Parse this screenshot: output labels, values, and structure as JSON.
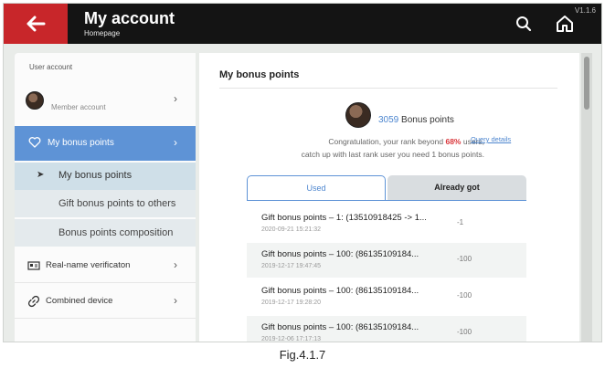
{
  "header": {
    "title": "My account",
    "subtitle": "Homepage",
    "version": "V1.1.6"
  },
  "sidebar": {
    "section_label": "User account",
    "member_label": "Member account",
    "bonus_label": "My bonus points",
    "sub_items": [
      "My bonus points",
      "Gift bonus points to others",
      "Bonus points composition"
    ],
    "realname_label": "Real-name verificaton",
    "combined_label": "Combined device"
  },
  "main": {
    "title": "My bonus points",
    "points_value": "3059",
    "points_label": " Bonus points",
    "congrats_prefix": "Congratulation, your rank beyond ",
    "congrats_pct": "68%",
    "congrats_suffix": " users,",
    "congrats_line2": "catch up with last rank user you need 1 bonus points.",
    "query_link": "Query details",
    "tabs": [
      "Used",
      "Already got"
    ],
    "records": [
      {
        "desc": "Gift bonus points  –  1: (13510918425 -> 1...",
        "date": "2020-09-21 15:21:32",
        "amount": "-1"
      },
      {
        "desc": "Gift bonus points  –  100: (86135109184...",
        "date": "2019-12-17 19:47:45",
        "amount": "-100"
      },
      {
        "desc": "Gift bonus points  –  100: (86135109184...",
        "date": "2019-12-17 19:28:20",
        "amount": "-100"
      },
      {
        "desc": "Gift bonus points  –  100: (86135109184...",
        "date": "2019-12-06 17:17:13",
        "amount": "-100"
      }
    ]
  },
  "caption": "Fig.4.1.7",
  "colors": {
    "accent_blue": "#5e93d6",
    "back_red": "#c8262a",
    "highlight_red": "#d9353a"
  }
}
